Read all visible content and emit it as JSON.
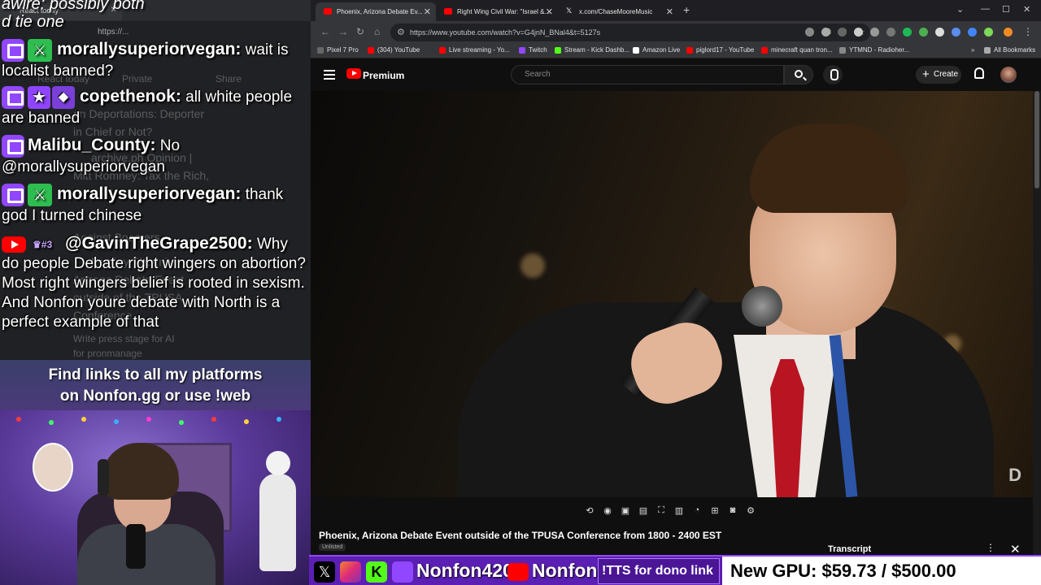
{
  "left_browser": {
    "tab_title": "React today",
    "url": "https://...",
    "ghost_lines": [
      "React today",
      "Private",
      "Share",
      "on Deportations: Deporter",
      "in Chief or Not?",
      "archive.ph  Opinion |",
      "Mitt Romney: Tax the Rich,",
      "Against Boomers",
      "Destiny Phoenix",
      "Arizona Debate Event",
      "outside of the TPUSA",
      "Conference...",
      "Write press stage for AI",
      "for pronmanage"
    ]
  },
  "chat": {
    "top_line": "awire: possibly both\nd tie one",
    "messages": [
      {
        "platform": "twitch",
        "user": "morallysuperiorvegan:",
        "text": " wait is localist banned?"
      },
      {
        "platform": "twitch",
        "user": "copethenok:",
        "text": " all white people are banned"
      },
      {
        "platform": "twitch",
        "user": "Malibu_County:",
        "text": " No @morallysuperiorvegan"
      },
      {
        "platform": "twitch",
        "user": "morallysuperiorvegan:",
        "text": " thank god I turned chinese"
      },
      {
        "platform": "youtube",
        "user": "@GavinTheGrape2500:",
        "text": " Why do people Debate right wingers on abortion? Most right wingers belief is rooted in sexism. And Nonfon youre debate with North is a perfect example of that"
      }
    ],
    "badge_rank": "#3"
  },
  "links_banner": {
    "line1": "Find links to all my platforms",
    "line2": "on Nonfon.gg or use !web"
  },
  "browser": {
    "tabs": [
      {
        "label": "Phoenix, Arizona Debate Ev...",
        "active": true
      },
      {
        "label": "Right Wing Civil War: \"Israel &...",
        "active": false
      },
      {
        "label": "x.com/ChaseMooreMusic",
        "active": false
      }
    ],
    "url": "https://www.youtube.com/watch?v=G4jnN_BNal4&t=5127s",
    "bookmarks": [
      "Pixel 7 Pro",
      "(304) YouTube",
      "Live streaming - Yo...",
      "Twitch",
      "Stream - Kick Dashb...",
      "Amazon Live",
      "piglord17 - YouTube",
      "minecraft quan tron...",
      "YTMND - Radioher..."
    ],
    "all_bookmarks": "All Bookmarks"
  },
  "youtube": {
    "brand": "Premium",
    "search_placeholder": "Search",
    "create_label": "Create",
    "video_title": "Phoenix, Arizona Debate Event outside of the TPUSA Conference from 1800 - 2400 EST",
    "visibility": "Unlisted",
    "transcript_label": "Transcript",
    "watermark": "D"
  },
  "bottom_bar": {
    "handle1": "Nonfon420",
    "handle2": "Nonfon",
    "tts": "!TTS for dono link",
    "gpu_goal": "New GPU: $59.73 / $500.00",
    "gpu_progress": 0.119
  }
}
